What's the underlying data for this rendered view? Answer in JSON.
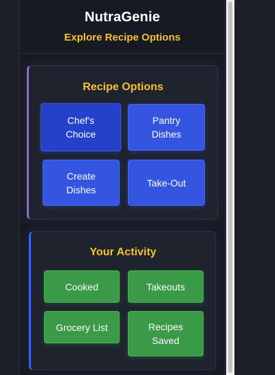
{
  "header": {
    "title": "NutraGenie",
    "subtitle": "Explore Recipe Options"
  },
  "recipe_options": {
    "title": "Recipe Options",
    "buttons": [
      {
        "label": "Chef's\nChoice"
      },
      {
        "label": "Pantry\nDishes"
      },
      {
        "label": "Create\nDishes"
      },
      {
        "label": "Take-Out"
      }
    ]
  },
  "activity": {
    "title": "Your Activity",
    "buttons": [
      {
        "label": "Cooked"
      },
      {
        "label": "Takeouts"
      },
      {
        "label": "Grocery List"
      },
      {
        "label": "Recipes\nSaved"
      }
    ]
  },
  "colors": {
    "accent_yellow": "#f2c233",
    "button_blue": "#3355e0",
    "button_green": "#3a9a48",
    "panel_bg": "#171a22"
  }
}
